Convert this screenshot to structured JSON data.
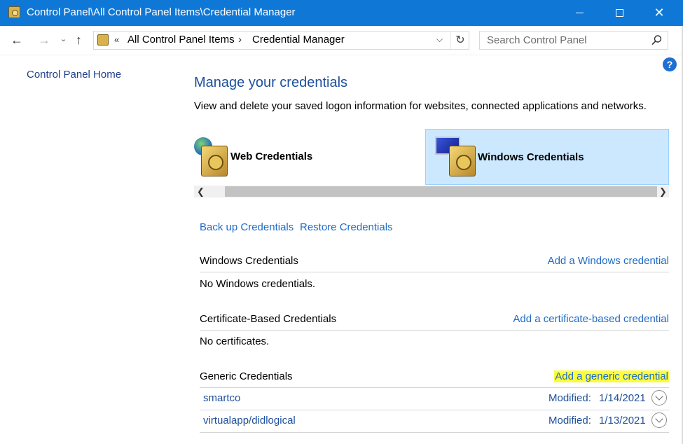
{
  "window": {
    "title": "Control Panel\\All Control Panel Items\\Credential Manager",
    "accent_color": "#0f78d7"
  },
  "address": {
    "chevron": "«",
    "crumb1": "All Control Panel Items",
    "separator": "›",
    "crumb2": "Credential Manager",
    "search_placeholder": "Search Control Panel"
  },
  "sidebar": {
    "home_link": "Control Panel Home"
  },
  "help_label": "?",
  "main": {
    "title": "Manage your credentials",
    "description": "View and delete your saved logon information for websites, connected applications and networks.",
    "tabs": [
      {
        "label": "Web Credentials",
        "selected": false
      },
      {
        "label": "Windows Credentials",
        "selected": true
      }
    ],
    "backup_link": "Back up Credentials",
    "restore_link": "Restore Credentials",
    "sections": [
      {
        "header": "Windows Credentials",
        "add_link": "Add a Windows credential",
        "empty_text": "No Windows credentials."
      },
      {
        "header": "Certificate-Based Credentials",
        "add_link": "Add a certificate-based credential",
        "empty_text": "No certificates."
      },
      {
        "header": "Generic Credentials",
        "add_link": "Add a generic credential",
        "items": [
          {
            "name": "smartco",
            "modified_label": "Modified:",
            "modified_date": "1/14/2021"
          },
          {
            "name": "virtualapp/didlogical",
            "modified_label": "Modified:",
            "modified_date": "1/13/2021"
          }
        ]
      }
    ]
  }
}
